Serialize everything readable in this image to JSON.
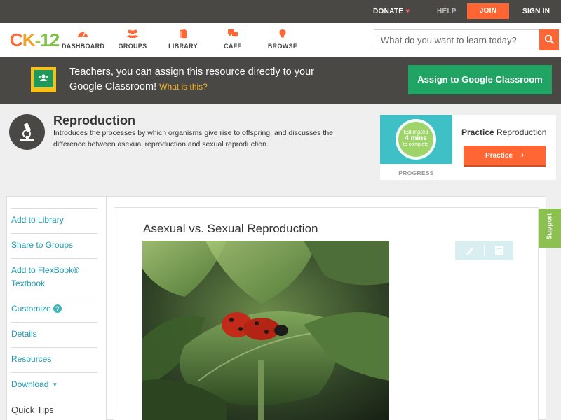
{
  "topbar": {
    "donate": "DONATE",
    "help": "HELP",
    "join": "JOIN",
    "sign_in": "SIGN IN"
  },
  "header": {
    "logo": {
      "c": "C",
      "k": "K",
      "dash": "-",
      "n": "12"
    },
    "nav": {
      "dashboard": "DASHBOARD",
      "groups": "GROUPS",
      "library": "LIBRARY",
      "cafe": "CAFE",
      "browse": "BROWSE"
    },
    "search": {
      "placeholder": "What do you want to learn today?"
    }
  },
  "banner": {
    "text": "Teachers, you can assign this resource directly to your Google Classroom!",
    "what_link": "What is this?",
    "assign_button": "Assign to Google Classroom"
  },
  "concept": {
    "title": "Reproduction",
    "description": "Introduces the processes by which organisms give rise to offspring, and discusses the difference between asexual reproduction and sexual reproduction."
  },
  "practice": {
    "estimated": "Estimated",
    "mins": "4 mins",
    "to_complete": "to complete",
    "progress_label": "PROGRESS",
    "title_bold": "Practice",
    "title_rest": "Reproduction",
    "button": "Practice"
  },
  "sidebar": {
    "items": [
      {
        "label": "Add to Library"
      },
      {
        "label": "Share to Groups"
      },
      {
        "label": "Add to FlexBook® Textbook"
      },
      {
        "label": "Customize"
      },
      {
        "label": "Details"
      },
      {
        "label": "Resources"
      },
      {
        "label": "Download"
      },
      {
        "label": "Quick Tips"
      }
    ]
  },
  "lesson": {
    "title": "Asexual vs. Sexual Reproduction"
  },
  "support_tab": "Support",
  "colors": {
    "brand_orange": "#ff6633",
    "classroom_green": "#1fa464",
    "teal_link": "#1f9bb0",
    "support_green": "#8cc152"
  }
}
